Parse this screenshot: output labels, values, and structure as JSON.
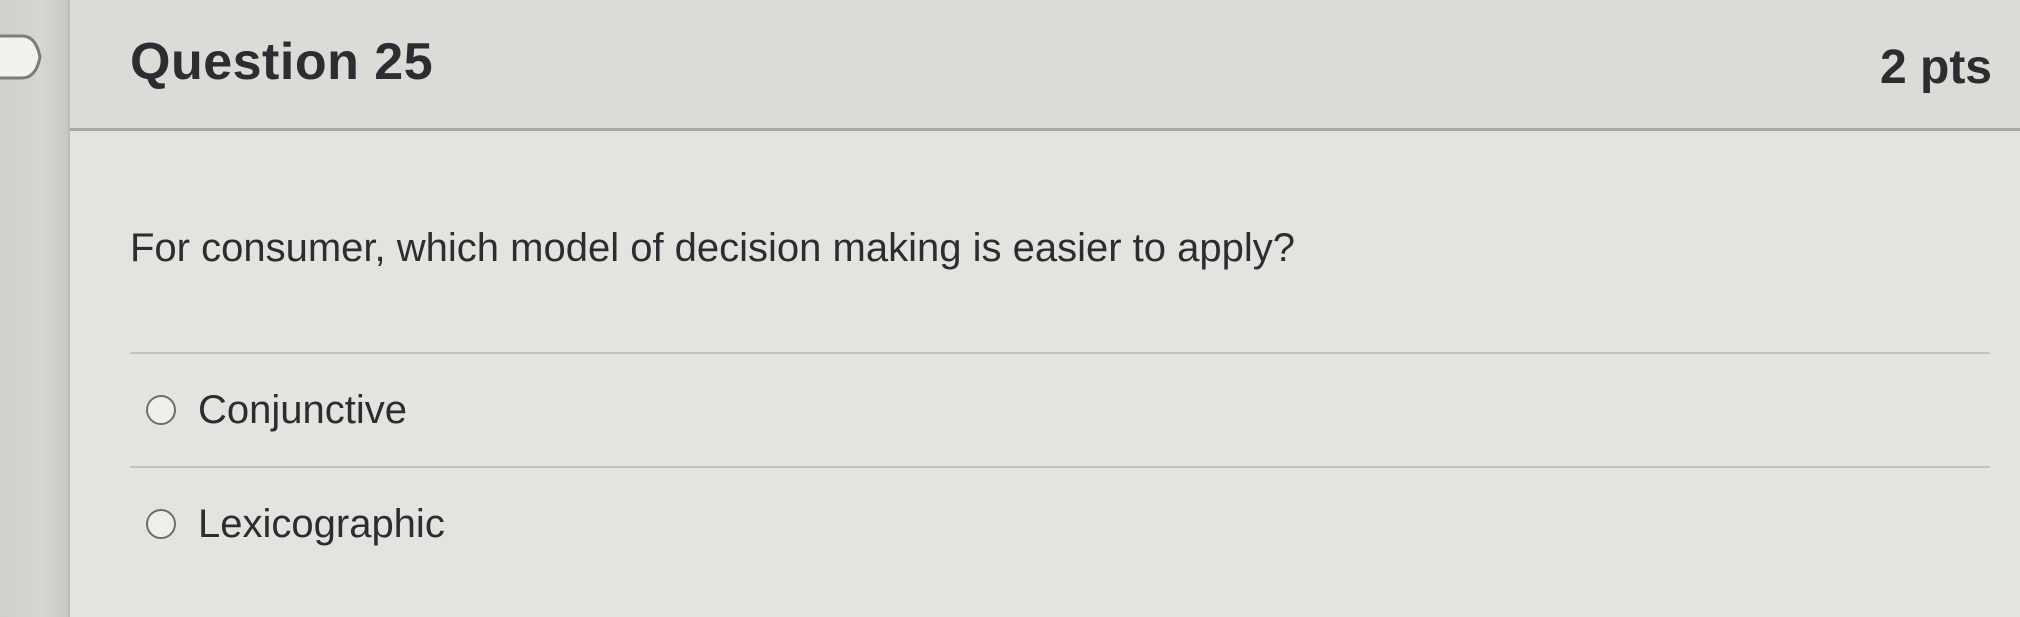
{
  "question": {
    "title": "Question 25",
    "points": "2 pts",
    "text": "For consumer, which model of decision making is easier to apply?"
  },
  "answers": [
    {
      "label": "Conjunctive",
      "selected": false
    },
    {
      "label": "Lexicographic",
      "selected": false
    }
  ],
  "icons": {
    "flag": "flag-icon",
    "radio": "radio-unselected-icon"
  }
}
